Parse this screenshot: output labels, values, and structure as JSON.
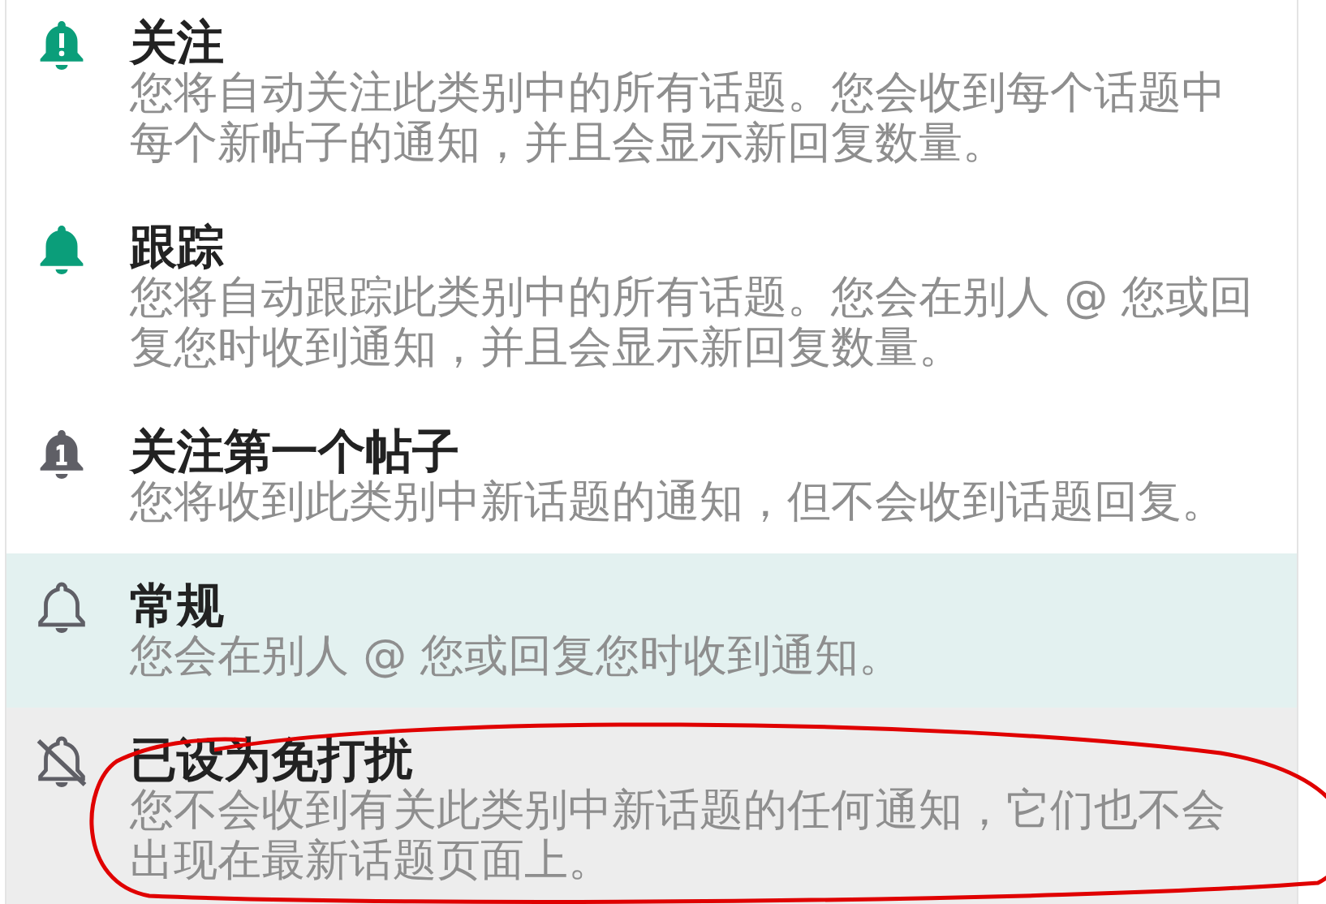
{
  "items": [
    {
      "kind": "watching",
      "title": "关注",
      "description": "您将自动关注此类别中的所有话题。您会收到每个话题中每个新帖子的通知，并且会显示新回复数量。",
      "selected": false,
      "hovered": false,
      "circled": false
    },
    {
      "kind": "tracking",
      "title": "跟踪",
      "description": "您将自动跟踪此类别中的所有话题。您会在别人 @ 您或回复您时收到通知，并且会显示新回复数量。",
      "selected": false,
      "hovered": false,
      "circled": false
    },
    {
      "kind": "watching_first",
      "title": "关注第一个帖子",
      "description": "您将收到此类别中新话题的通知，但不会收到话题回复。",
      "selected": false,
      "hovered": false,
      "circled": false
    },
    {
      "kind": "regular",
      "title": "常规",
      "description": "您会在别人 @ 您或回复您时收到通知。",
      "selected": true,
      "hovered": false,
      "circled": false
    },
    {
      "kind": "muted",
      "title": "已设为免打扰",
      "description": "您不会收到有关此类别中新话题的任何通知，它们也不会出现在最新话题页面上。",
      "selected": false,
      "hovered": true,
      "circled": true
    }
  ]
}
